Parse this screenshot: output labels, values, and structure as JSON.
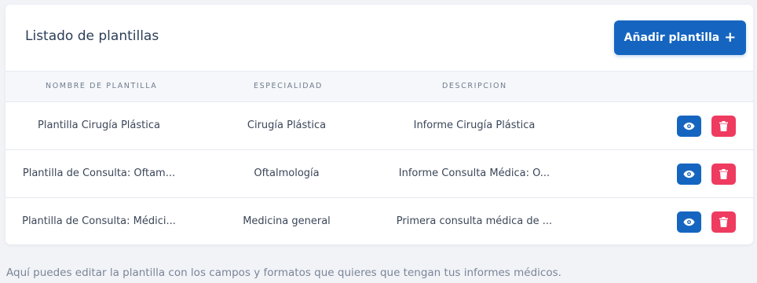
{
  "card": {
    "title": "Listado de plantillas",
    "add_button": {
      "label": "Añadir plantilla",
      "icon": "plus-icon"
    }
  },
  "table": {
    "headers": [
      "NOMBRE DE PLANTILLA",
      "ESPECIALIDAD",
      "DESCRIPCION"
    ],
    "rows": [
      {
        "name": "Plantilla Cirugía Plástica",
        "specialty": "Cirugía Plástica",
        "description": "Informe Cirugía Plástica"
      },
      {
        "name": "Plantilla de Consulta: Oftam...",
        "specialty": "Oftalmología",
        "description": "Informe Consulta Médica: O..."
      },
      {
        "name": "Plantilla de Consulta: Médici...",
        "specialty": "Medicina general",
        "description": "Primera consulta médica de ..."
      }
    ],
    "actions": {
      "view_icon": "eye-icon",
      "delete_icon": "trash-icon"
    }
  },
  "footer": {
    "text": "Aquí puedes editar la plantilla con los campos y formatos que quieres que tengan tus informes médicos."
  },
  "colors": {
    "primary": "#1565c0",
    "danger": "#ee3b5f",
    "background": "#f1f3f7"
  }
}
